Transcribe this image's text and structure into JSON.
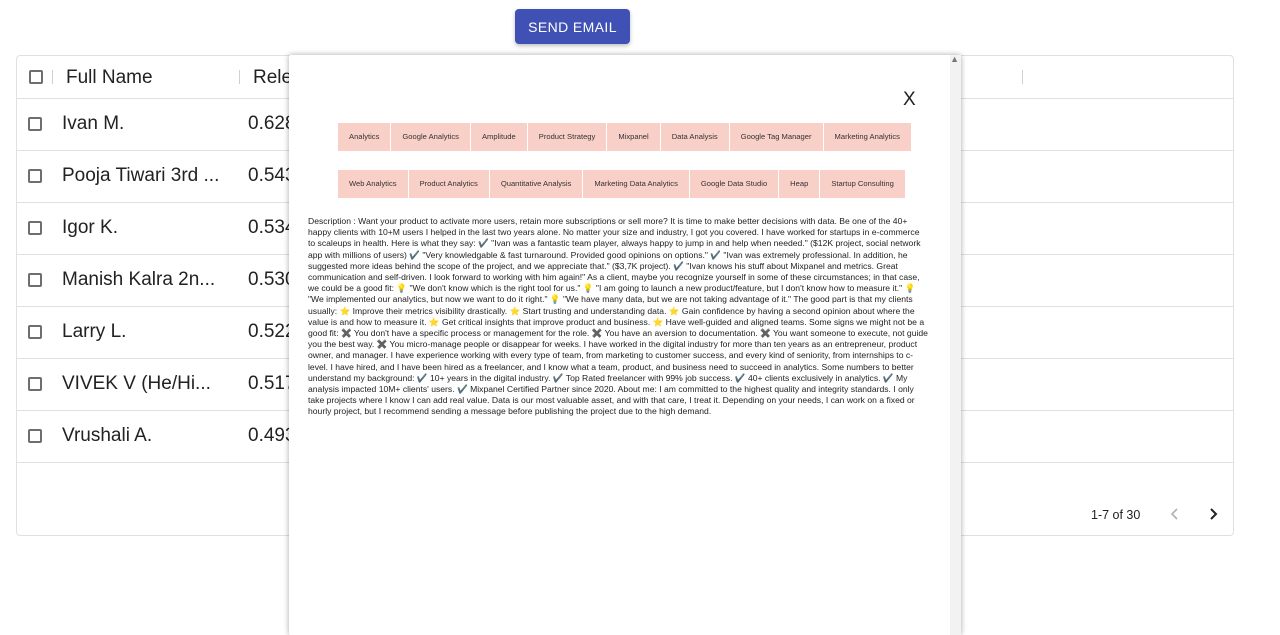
{
  "toolbar": {
    "send_email_label": "SEND EMAIL"
  },
  "grid": {
    "headers": {
      "full_name": "Full Name",
      "relevance": "Rele"
    },
    "rows": [
      {
        "name": "Ivan M.",
        "score": "0.628"
      },
      {
        "name": "Pooja Tiwari 3rd ...",
        "score": "0.543"
      },
      {
        "name": "Igor K.",
        "score": "0.534"
      },
      {
        "name": "Manish Kalra 2n...",
        "score": "0.530"
      },
      {
        "name": "Larry L.",
        "score": "0.522"
      },
      {
        "name": "VIVEK V (He/Hi...",
        "score": "0.517"
      },
      {
        "name": "Vrushali A.",
        "score": "0.493"
      }
    ],
    "pagination": {
      "range": "1-7 of 30"
    }
  },
  "modal": {
    "close_label": "X",
    "tags_row1": [
      "Analytics",
      "Google Analytics",
      "Amplitude",
      "Product Strategy",
      "Mixpanel",
      "Data Analysis",
      "Google Tag Manager",
      "Marketing Analytics"
    ],
    "tags_row2": [
      "Web Analytics",
      "Product Analytics",
      "Quantitative Analysis",
      "Marketing Data Analytics",
      "Google Data Studio",
      "Heap",
      "Startup Consulting"
    ],
    "description": "Description : Want your product to activate more users, retain more subscriptions or sell more? It is time to make better decisions with data. Be one of the 40+ happy clients with 10+M users I helped in the last two years alone. No matter your size and industry, I got you covered. I have worked for startups in e-commerce to scaleups in health. Here is what they say: ✔️ \"Ivan was a fantastic team player, always happy to jump in and help when needed.\" ($12K project, social network app with millions of users) ✔️ \"Very knowledgable & fast turnaround. Provided good opinions on options.\" ✔️ \"Ivan was extremely professional. In addition, he suggested more ideas behind the scope of the project, and we appreciate that.\" ($3,7K project). ✔️ \"Ivan knows his stuff about Mixpanel and metrics. Great communication and self-driven. I look forward to working with him again!\" As a client, maybe you recognize yourself in some of these circumstances; in that case, we could be a good fit: 💡 \"We don't know which is the right tool for us.\" 💡 \"I am going to launch a new product/feature, but I don't know how to measure it.\" 💡 \"We implemented our analytics, but now we want to do it right.\" 💡 \"We have many data, but we are not taking advantage of it.\" The good part is that my clients usually: ⭐ Improve their metrics visibility drastically. ⭐ Start trusting and understanding data. ⭐ Gain confidence by having a second opinion about where the value is and how to measure it. ⭐ Get critical insights that improve product and business. ⭐ Have well-guided and aligned teams. Some signs we might not be a good fit: ✖️ You don't have a specific process or management for the role. ✖️ You have an aversion to documentation. ✖️ You want someone to execute, not guide you the best way. ✖️ You micro-manage people or disappear for weeks. I have worked in the digital industry for more than ten years as an entrepreneur, product owner, and manager. I have experience working with every type of team, from marketing to customer success, and every kind of seniority, from internships to c-level. I have hired, and I have been hired as a freelancer, and I know what a team, product, and business need to succeed in analytics. Some numbers to better understand my background: ✔️ 10+ years in the digital industry. ✔️ Top Rated freelancer with 99% job success. ✔️ 40+ clients exclusively in analytics. ✔️ My analysis impacted 10M+ clients' users. ✔️ Mixpanel Certified Partner since 2020. About me: I am committed to the highest quality and integrity standards. I only take projects where I know I can add real value. Data is our most valuable asset, and with that care, I treat it. Depending on your needs, I can work on a fixed or hourly project, but I recommend sending a message before publishing the project due to the high demand."
  },
  "colors": {
    "primary": "#3f51b5",
    "tag_bg": "#f9d0c7",
    "border": "#e0e0e0"
  },
  "icons": {
    "prev": "chevron-left-icon",
    "next": "chevron-right-icon",
    "scroll_up": "scroll-up-arrow-icon"
  }
}
